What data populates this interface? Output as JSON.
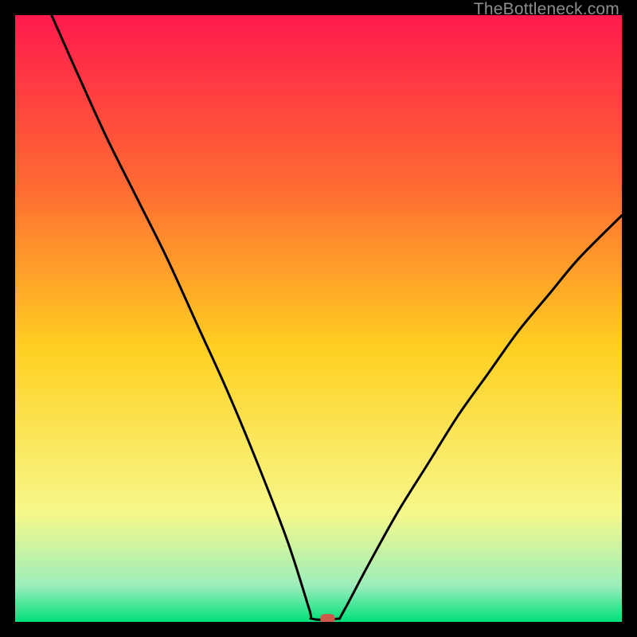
{
  "watermark": "TheBottleneck.com",
  "chart_data": {
    "type": "line",
    "title": "",
    "xlabel": "",
    "ylabel": "",
    "xlim": [
      0,
      100
    ],
    "ylim": [
      0,
      100
    ],
    "grid": false,
    "background_gradient": {
      "top": "#ff1a4d",
      "upper_mid": "#ff6a33",
      "mid": "#ffd021",
      "lower_mid": "#f7f88a",
      "near_bottom": "#9ceebb",
      "bottom": "#00e07a"
    },
    "series": [
      {
        "name": "bottleneck-curve",
        "color": "#000000",
        "points": [
          {
            "x": 6.0,
            "y": 100.0
          },
          {
            "x": 10.0,
            "y": 91.0
          },
          {
            "x": 15.0,
            "y": 80.0
          },
          {
            "x": 20.0,
            "y": 70.0
          },
          {
            "x": 25.0,
            "y": 60.0
          },
          {
            "x": 30.0,
            "y": 49.0
          },
          {
            "x": 35.0,
            "y": 38.0
          },
          {
            "x": 40.0,
            "y": 26.0
          },
          {
            "x": 45.0,
            "y": 13.0
          },
          {
            "x": 48.5,
            "y": 2.0
          },
          {
            "x": 49.0,
            "y": 0.5
          },
          {
            "x": 53.0,
            "y": 0.5
          },
          {
            "x": 54.0,
            "y": 1.5
          },
          {
            "x": 58.0,
            "y": 9.0
          },
          {
            "x": 63.0,
            "y": 18.0
          },
          {
            "x": 68.0,
            "y": 26.0
          },
          {
            "x": 73.0,
            "y": 34.0
          },
          {
            "x": 78.0,
            "y": 41.0
          },
          {
            "x": 83.0,
            "y": 48.0
          },
          {
            "x": 88.0,
            "y": 54.0
          },
          {
            "x": 93.0,
            "y": 60.0
          },
          {
            "x": 100.0,
            "y": 67.0
          }
        ]
      }
    ],
    "marker": {
      "name": "sweet-spot",
      "x": 51.5,
      "y": 0.5,
      "shape": "rounded-rect",
      "width_pct": 2.4,
      "height_pct": 1.6,
      "fill": "#cc5a4a"
    }
  }
}
